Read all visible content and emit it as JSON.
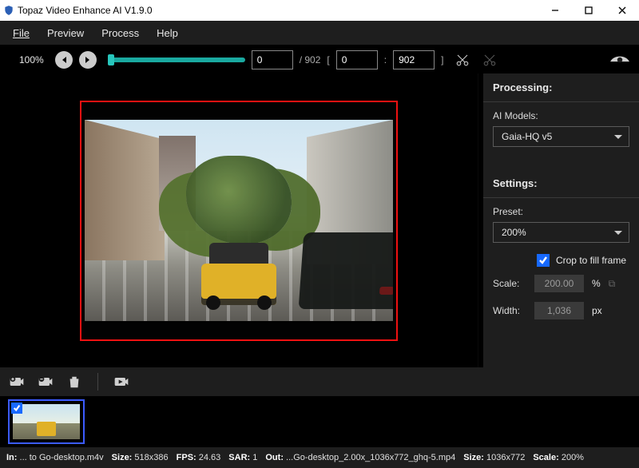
{
  "window": {
    "title": "Topaz Video Enhance AI V1.9.0"
  },
  "menu": {
    "file": "File",
    "preview": "Preview",
    "process": "Process",
    "help": "Help"
  },
  "toolbar": {
    "zoom": "100%",
    "frame_current": "0",
    "frame_total": "902",
    "range_start": "0",
    "range_end": "902"
  },
  "panel": {
    "processing_hdr": "Processing:",
    "ai_models_label": "AI Models:",
    "model_selected": "Gaia-HQ v5",
    "settings_hdr": "Settings:",
    "preset_label": "Preset:",
    "preset_selected": "200%",
    "crop_label": "Crop to fill frame",
    "scale_label": "Scale:",
    "scale_value": "200.00",
    "scale_unit": "%",
    "width_label": "Width:",
    "width_value": "1,036",
    "width_unit": "px"
  },
  "status": {
    "in_label": "In:",
    "in_value": "... to Go-desktop.m4v",
    "size_label": "Size:",
    "size_in": "518x386",
    "fps_label": "FPS:",
    "fps": "24.63",
    "sar_label": "SAR:",
    "sar": "1",
    "out_label": "Out:",
    "out_value": "...Go-desktop_2.00x_1036x772_ghq-5.mp4",
    "size_out": "1036x772",
    "scale_label": "Scale:",
    "scale_out": "200%"
  }
}
